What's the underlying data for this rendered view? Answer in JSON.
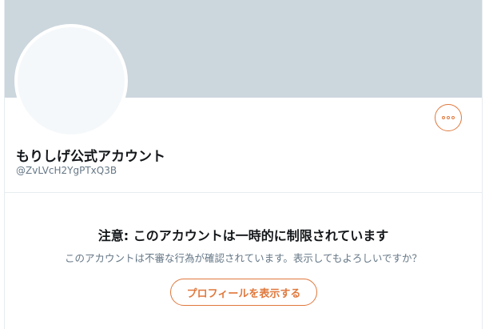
{
  "profile": {
    "display_name": "もりしげ公式アカウント",
    "handle": "@ZvLVcH2YgPTxQ3B",
    "more_icon": "more-horizontal-icon"
  },
  "notice": {
    "title": "注意: このアカウントは一時的に制限されています",
    "body": "このアカウントは不審な行為が確認されています。表示してもよろしいですか？",
    "button_label": "プロフィールを表示する"
  },
  "colors": {
    "banner": "#ccd6dd",
    "accent": "#e0783c",
    "avatar_fill": "#f5f8fa",
    "primary_text": "#14171a",
    "secondary_text": "#657786"
  }
}
